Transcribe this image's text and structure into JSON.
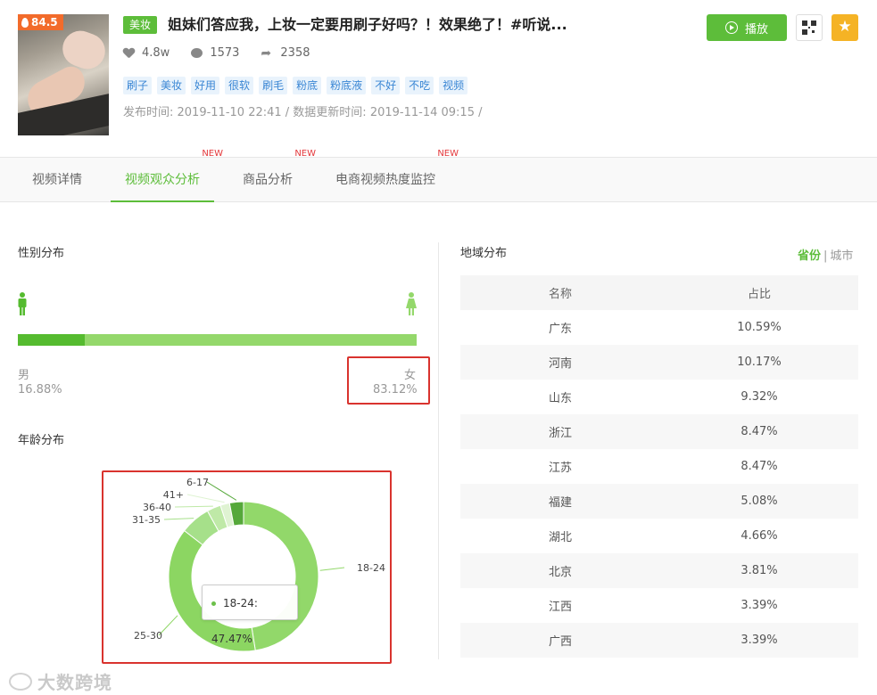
{
  "video": {
    "heat_score": "84.5",
    "category_tag": "美妆",
    "title": "姐妹们答应我，上妆一定要用刷子好吗？！效果绝了！#听说...",
    "likes": "4.8w",
    "comments": "1573",
    "shares": "2358",
    "tags": [
      "刷子",
      "美妆",
      "好用",
      "很软",
      "刷毛",
      "粉底",
      "粉底液",
      "不好",
      "不吃",
      "视频"
    ],
    "meta": "发布时间: 2019-11-10 22:41 / 数据更新时间: 2019-11-14 09:15 /"
  },
  "actions": {
    "play_label": "播放"
  },
  "tabs": [
    {
      "label": "视频详情",
      "new": ""
    },
    {
      "label": "视频观众分析",
      "new": "NEW"
    },
    {
      "label": "商品分析",
      "new": "NEW"
    },
    {
      "label": "电商视频热度监控",
      "new": "NEW"
    }
  ],
  "gender": {
    "title": "性别分布",
    "male_label": "男",
    "male_value": "16.88%",
    "male_fraction": 0.1688,
    "female_label": "女",
    "female_value": "83.12%",
    "colors": {
      "male": "#55bb2f",
      "female": "#94d86b"
    }
  },
  "age": {
    "title": "年龄分布",
    "tooltip": "18-24: 47.47%"
  },
  "chart_data": {
    "type": "pie",
    "categories": [
      "18-24",
      "25-30",
      "31-35",
      "36-40",
      "41+",
      "6-17"
    ],
    "values": [
      47.47,
      38.0,
      6.5,
      3.0,
      2.0,
      3.0
    ],
    "donut": true
  },
  "region": {
    "title": "地域分布",
    "switch_on": "省份",
    "switch_sep": "|",
    "switch_off": "城市",
    "columns": [
      "名称",
      "占比"
    ],
    "rows": [
      [
        "广东",
        "10.59%"
      ],
      [
        "河南",
        "10.17%"
      ],
      [
        "山东",
        "9.32%"
      ],
      [
        "浙江",
        "8.47%"
      ],
      [
        "江苏",
        "8.47%"
      ],
      [
        "福建",
        "5.08%"
      ],
      [
        "湖北",
        "4.66%"
      ],
      [
        "北京",
        "3.81%"
      ],
      [
        "江西",
        "3.39%"
      ],
      [
        "广西",
        "3.39%"
      ]
    ]
  },
  "watermark": "大数跨境"
}
